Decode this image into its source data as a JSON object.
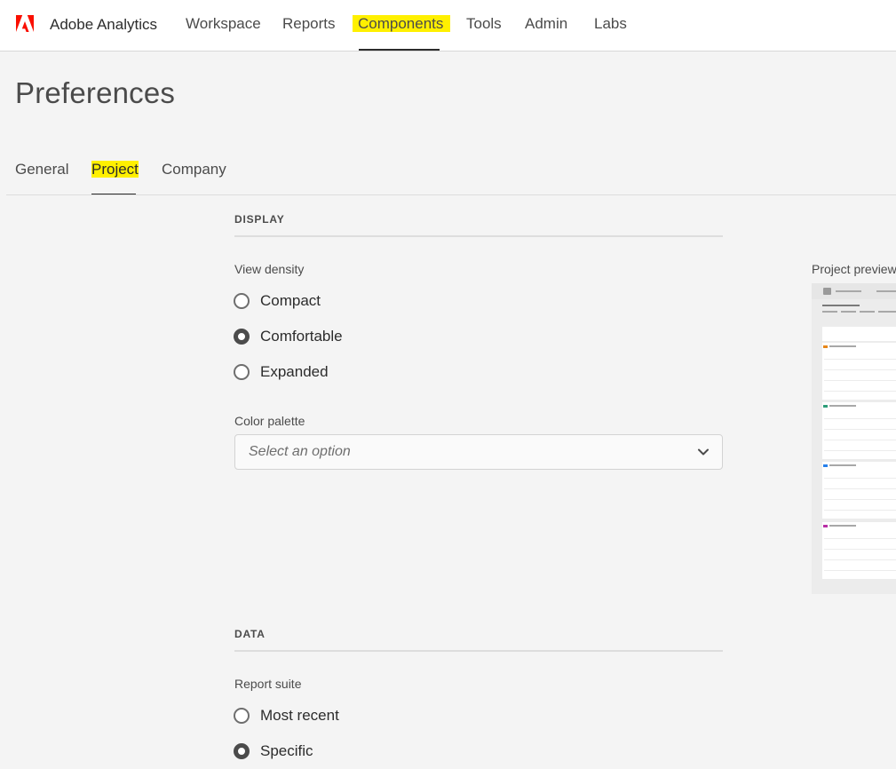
{
  "app": {
    "name": "Adobe Analytics",
    "logo_icon": "adobe-logo-icon",
    "brand_color": "#fa0f00"
  },
  "nav": {
    "items": [
      {
        "label": "Workspace"
      },
      {
        "label": "Reports"
      },
      {
        "label": "Components",
        "active": true
      },
      {
        "label": "Tools"
      },
      {
        "label": "Admin"
      },
      {
        "label": "Labs"
      }
    ]
  },
  "page": {
    "title": "Preferences"
  },
  "tabs": [
    {
      "label": "General"
    },
    {
      "label": "Project",
      "active": true
    },
    {
      "label": "Company"
    }
  ],
  "display": {
    "heading": "DISPLAY",
    "view_density": {
      "label": "View density",
      "options": [
        {
          "label": "Compact",
          "checked": false
        },
        {
          "label": "Comfortable",
          "checked": true
        },
        {
          "label": "Expanded",
          "checked": false
        }
      ]
    },
    "color_palette": {
      "label": "Color palette",
      "placeholder": "Select an option",
      "icon": "chevron-down-icon"
    }
  },
  "preview": {
    "label": "Project preview",
    "accent_colors": [
      "#e68619",
      "#2d9d78",
      "#2680eb",
      "#b82fa5"
    ]
  },
  "data_section": {
    "heading": "DATA",
    "report_suite": {
      "label": "Report suite",
      "options": [
        {
          "label": "Most recent",
          "checked": false
        },
        {
          "label": "Specific",
          "checked": true
        }
      ]
    }
  },
  "highlight_color": "#fff000"
}
